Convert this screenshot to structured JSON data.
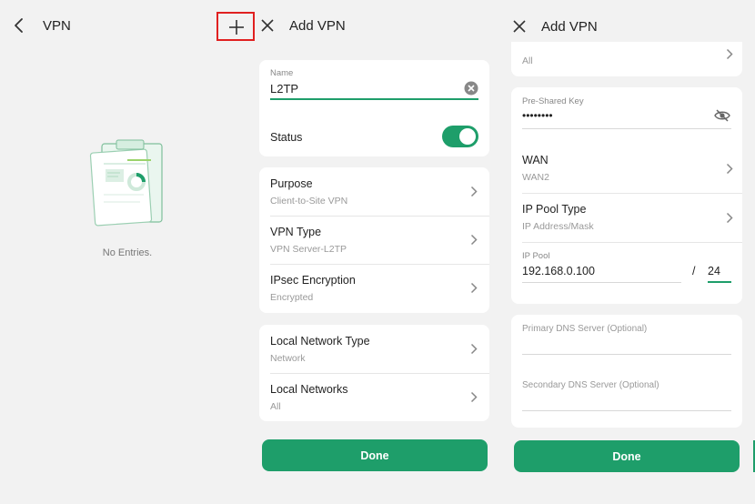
{
  "screen1": {
    "title": "VPN",
    "empty_text": "No Entries."
  },
  "screen2": {
    "title": "Add VPN",
    "name_label": "Name",
    "name_value": "L2TP",
    "status_label": "Status",
    "status_on": true,
    "rows_a": [
      {
        "label": "Purpose",
        "value": "Client-to-Site VPN"
      },
      {
        "label": "VPN Type",
        "value": "VPN Server-L2TP"
      },
      {
        "label": "IPsec Encryption",
        "value": "Encrypted"
      }
    ],
    "rows_b": [
      {
        "label": "Local Network Type",
        "value": "Network"
      },
      {
        "label": "Local Networks",
        "value": "All"
      }
    ],
    "done_label": "Done"
  },
  "screen3": {
    "title": "Add VPN",
    "top_value": "All",
    "psk_label": "Pre-Shared Key",
    "psk_value": "••••••••",
    "wan_label": "WAN",
    "wan_value": "WAN2",
    "ip_pool_type_label": "IP Pool Type",
    "ip_pool_type_value": "IP Address/Mask",
    "ip_pool_label": "IP Pool",
    "ip_pool_value": "192.168.0.100",
    "slash": "/",
    "mask_value": "24",
    "dns_primary_placeholder": "Primary DNS Server (Optional)",
    "dns_secondary_placeholder": "Secondary DNS Server (Optional)",
    "done_label": "Done"
  },
  "colors": {
    "accent": "#1e9e6a",
    "highlight": "#e02020",
    "background": "#f2f2f2"
  }
}
